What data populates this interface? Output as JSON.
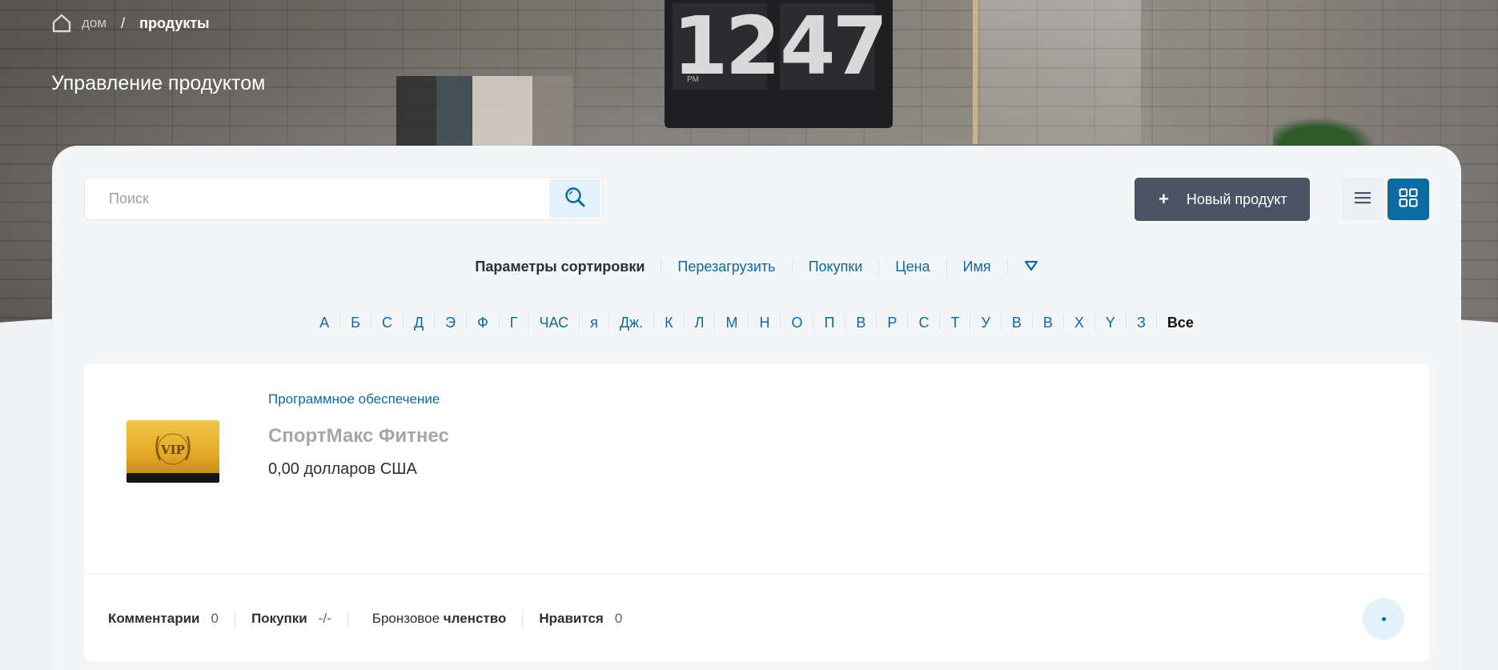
{
  "breadcrumb": {
    "home_label": "дом",
    "separator": "/",
    "current": "продукты"
  },
  "page": {
    "title": "Управление продуктом"
  },
  "hero_clock": {
    "hours": "12",
    "minutes": "47",
    "meridiem": "PM"
  },
  "toolbar": {
    "search_placeholder": "Поиск",
    "search_value": "",
    "new_product_label": "Новый продукт",
    "new_product_icon": "+",
    "active_view": "grid"
  },
  "sort": {
    "label": "Параметры сортировки",
    "options": [
      "Перезагрузить",
      "Покупки",
      "Цена",
      "Имя"
    ]
  },
  "alphabet": {
    "letters": [
      "А",
      "Б",
      "С",
      "Д",
      "Э",
      "Ф",
      "Г",
      "ЧАС",
      "я",
      "Дж.",
      "К",
      "Л",
      "М",
      "Н",
      "О",
      "П",
      "В",
      "Р",
      "С",
      "Т",
      "У",
      "В",
      "В",
      "Х",
      "Y",
      "З"
    ],
    "all_label": "Все"
  },
  "product": {
    "category": "Программное обеспечение",
    "name": "СпортМакс Фитнес",
    "price": "0,00 долларов США",
    "thumbnail_text": "VIP",
    "stats": {
      "comments_label": "Комментарии",
      "comments_value": "0",
      "purchases_label": "Покупки",
      "purchases_value": "-/-",
      "membership_prefix": "Бронзовое",
      "membership_bold": "членство",
      "likes_label": "Нравится",
      "likes_value": "0"
    }
  },
  "colors": {
    "accent": "#0b6aa0",
    "dark_button": "#4a5465",
    "light_accent_bg": "#e3f1fa"
  }
}
